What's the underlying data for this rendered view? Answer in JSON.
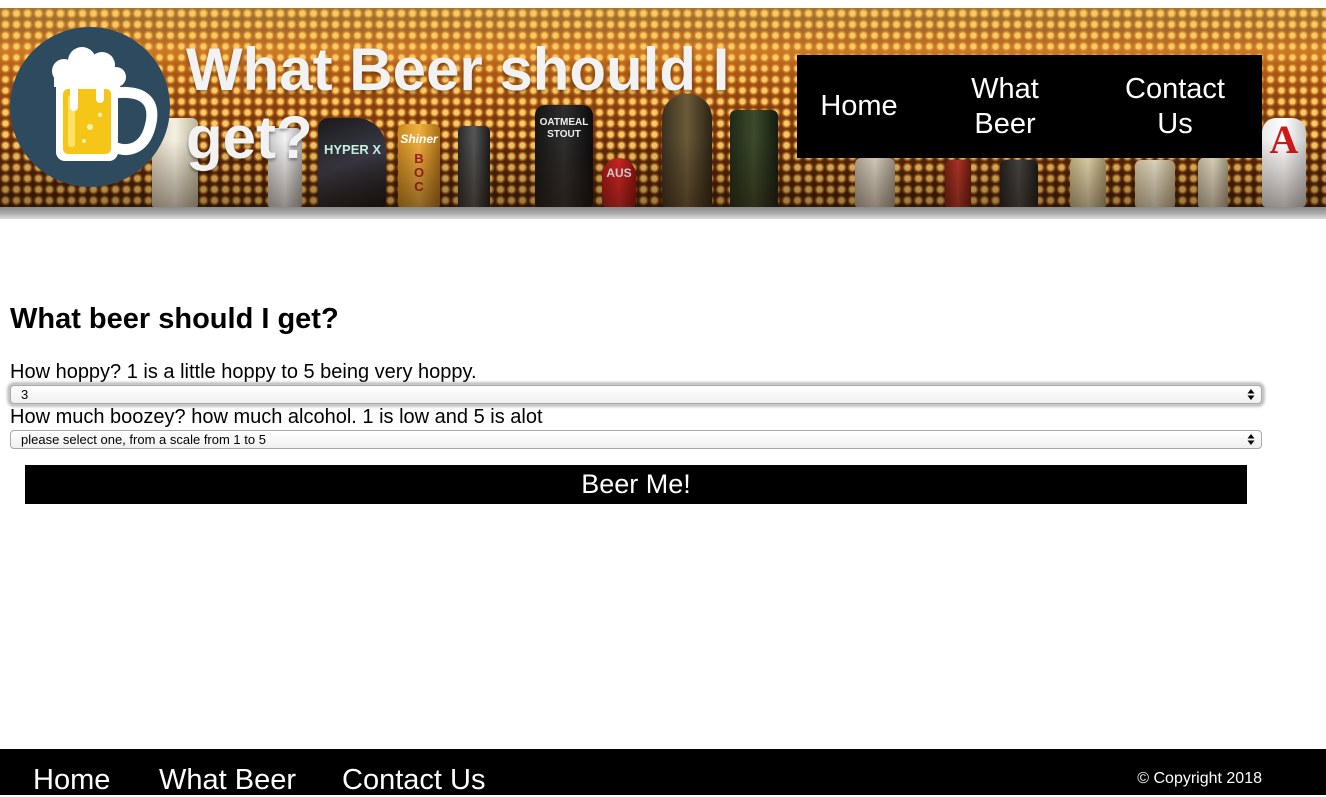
{
  "header": {
    "title": "What Beer should I get?",
    "nav": {
      "home": "Home",
      "what_beer": "What Beer",
      "contact_us": "Contact Us"
    }
  },
  "main": {
    "heading": "What beer should I get?",
    "hoppy": {
      "label": "How hoppy? 1 is a little hoppy to 5 being very hoppy.",
      "selected": "3"
    },
    "boozey": {
      "label": "How much boozey? how much alcohol. 1 is low and 5 is alot",
      "selected": "please select one, from a scale from 1 to 5"
    },
    "submit_label": "Beer Me!"
  },
  "footer": {
    "nav": {
      "home": "Home",
      "what_beer": "What Beer",
      "contact_us": "Contact Us"
    },
    "copyright": "© Copyright 2018"
  },
  "colors": {
    "nav_background": "#000000",
    "logo_circle": "#2e4a5e",
    "beer": "#f5c518",
    "foam": "#ffffff"
  },
  "icons": {
    "logo": "beer-mug-icon",
    "select_arrows": "updown-arrows-icon"
  },
  "banner_tap_labels": [
    "HYPER X",
    "Shiner",
    "BOCK",
    "OATMEAL STOUT",
    "AUS",
    "A"
  ]
}
